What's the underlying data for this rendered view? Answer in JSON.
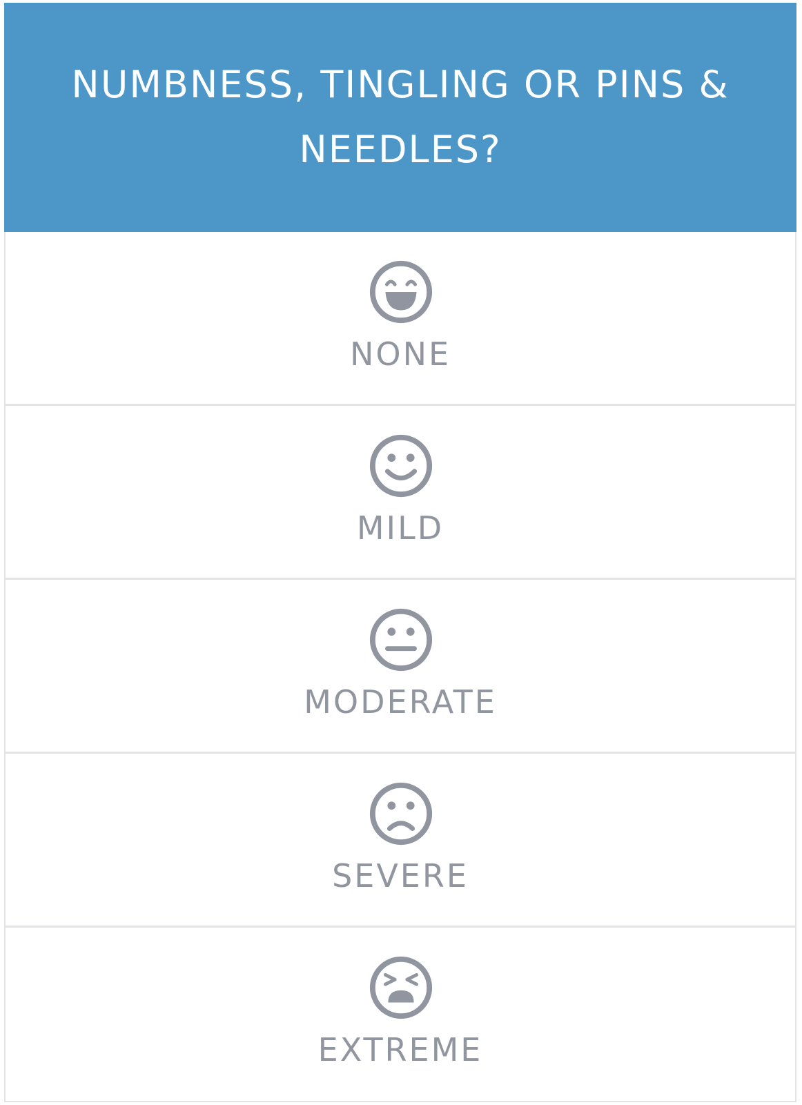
{
  "question": {
    "title": "NUMBNESS, TINGLING OR PINS & NEEDLES?"
  },
  "colors": {
    "header_background": "#4c96c8",
    "header_text": "#ffffff",
    "icon_and_label": "#90959f",
    "divider": "#e1e3e7"
  },
  "options": [
    {
      "label": "NONE",
      "icon": "grinning-face-icon"
    },
    {
      "label": "MILD",
      "icon": "smiling-face-icon"
    },
    {
      "label": "MODERATE",
      "icon": "neutral-face-icon"
    },
    {
      "label": "SEVERE",
      "icon": "frowning-face-icon"
    },
    {
      "label": "EXTREME",
      "icon": "tired-face-icon"
    }
  ]
}
